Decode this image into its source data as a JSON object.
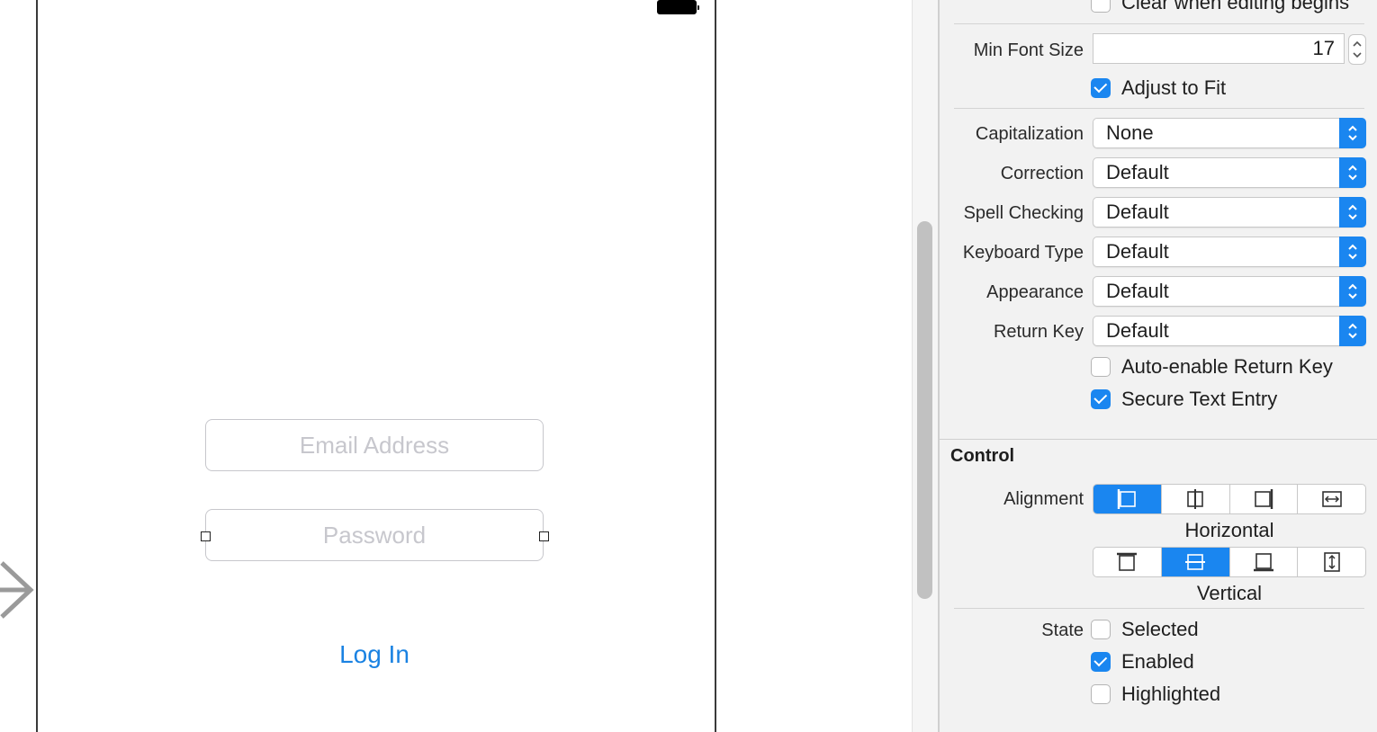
{
  "canvas": {
    "email_placeholder": "Email Address",
    "password_placeholder": "Password",
    "login_label": "Log In"
  },
  "inspector": {
    "clear_when_editing": {
      "label": "Clear when editing begins",
      "checked": false
    },
    "min_font_size": {
      "label": "Min Font Size",
      "value": "17"
    },
    "adjust_to_fit": {
      "label": "Adjust to Fit",
      "checked": true
    },
    "capitalization": {
      "label": "Capitalization",
      "value": "None"
    },
    "correction": {
      "label": "Correction",
      "value": "Default"
    },
    "spell_checking": {
      "label": "Spell Checking",
      "value": "Default"
    },
    "keyboard_type": {
      "label": "Keyboard Type",
      "value": "Default"
    },
    "appearance": {
      "label": "Appearance",
      "value": "Default"
    },
    "return_key": {
      "label": "Return Key",
      "value": "Default"
    },
    "auto_enable_return_key": {
      "label": "Auto-enable Return Key",
      "checked": false
    },
    "secure_text_entry": {
      "label": "Secure Text Entry",
      "checked": true
    },
    "control": {
      "title": "Control",
      "alignment_label": "Alignment",
      "horizontal_caption": "Horizontal",
      "horizontal_selected_index": 0,
      "vertical_caption": "Vertical",
      "vertical_selected_index": 1,
      "state_label": "State",
      "selected": {
        "label": "Selected",
        "checked": false
      },
      "enabled": {
        "label": "Enabled",
        "checked": true
      },
      "highlighted": {
        "label": "Highlighted",
        "checked": false
      }
    }
  },
  "colors": {
    "accent": "#1a86f0",
    "link": "#1a82e2",
    "placeholder": "#c7c7cd",
    "panel": "#f2f2f2"
  }
}
